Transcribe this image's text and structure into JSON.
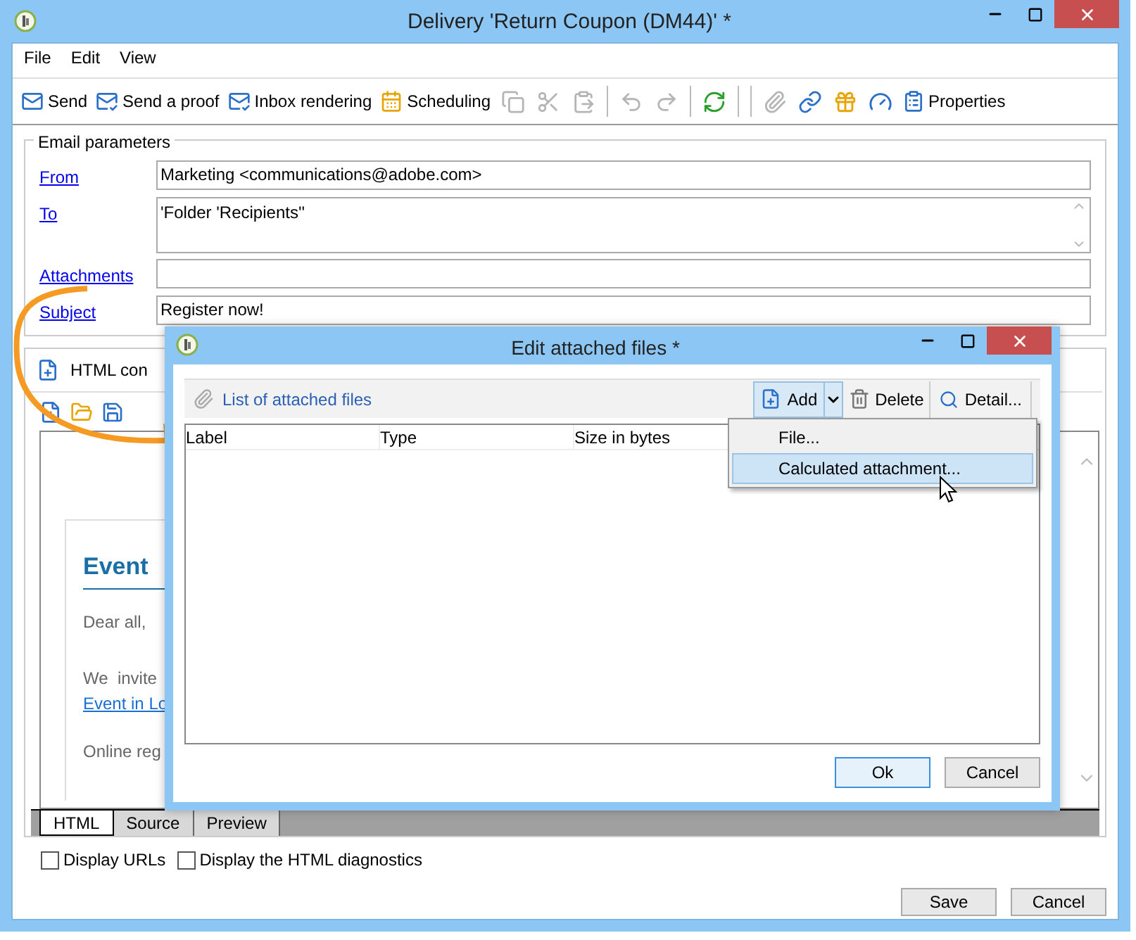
{
  "window": {
    "title": "Delivery 'Return Coupon (DM44)' *"
  },
  "menu": [
    "File",
    "Edit",
    "View"
  ],
  "toolbar": [
    {
      "kind": "button",
      "label": "Send",
      "disabled": false
    },
    {
      "kind": "button",
      "label": "Send a proof",
      "disabled": false
    },
    {
      "kind": "button",
      "label": "Inbox rendering",
      "disabled": false
    },
    {
      "kind": "button",
      "label": "Scheduling",
      "disabled": false
    },
    {
      "kind": "icon",
      "disabled": true
    },
    {
      "kind": "icon",
      "disabled": true
    },
    {
      "kind": "icon",
      "disabled": true
    },
    {
      "kind": "separator"
    },
    {
      "kind": "icon",
      "disabled": true
    },
    {
      "kind": "icon",
      "disabled": true
    },
    {
      "kind": "separator"
    },
    {
      "kind": "icon",
      "disabled": false
    },
    {
      "kind": "separator"
    },
    {
      "kind": "separator"
    },
    {
      "kind": "icon",
      "disabled": true
    },
    {
      "kind": "icon",
      "disabled": false
    },
    {
      "kind": "icon",
      "disabled": false
    },
    {
      "kind": "icon",
      "disabled": false
    },
    {
      "kind": "button",
      "label": "Properties",
      "disabled": false
    }
  ],
  "email_parameters": {
    "title": "Email parameters",
    "fields": [
      {
        "label": "From",
        "kind": "line",
        "value": "Marketing <communications@adobe.com>"
      },
      {
        "label": "To",
        "kind": "multiline",
        "value": "'Folder 'Recipients''"
      },
      {
        "label": "Attachments",
        "kind": "line"
      },
      {
        "label": "Subject",
        "kind": "line",
        "value": "Register now!"
      }
    ]
  },
  "content": {
    "tab": "HTML con",
    "preview": {
      "heading": "Event",
      "greeting": "Dear all,",
      "line_1": "We  invite",
      "link": "Event in Lo",
      "line_2": "Online reg"
    },
    "bottom_tabs": [
      {
        "label": "HTML",
        "selected": true
      },
      {
        "label": "Source",
        "selected": false
      },
      {
        "label": "Preview",
        "selected": false
      }
    ],
    "options": [
      {
        "label": "Display URLs",
        "checked": false
      },
      {
        "label": "Display the HTML diagnostics",
        "checked": false
      }
    ]
  },
  "buttons": [
    "Save",
    "Cancel"
  ],
  "dialog": {
    "title": "Edit attached files *",
    "list_link": "List of attached files",
    "actions": [
      "Add",
      "Delete",
      "Detail..."
    ],
    "columns": [
      "Label",
      "Type",
      "Size in bytes"
    ],
    "add_menu": [
      {
        "label": "File...",
        "selected": false
      },
      {
        "label": "Calculated attachment...",
        "selected": true
      }
    ],
    "buttons": [
      "Ok",
      "Cancel"
    ]
  }
}
